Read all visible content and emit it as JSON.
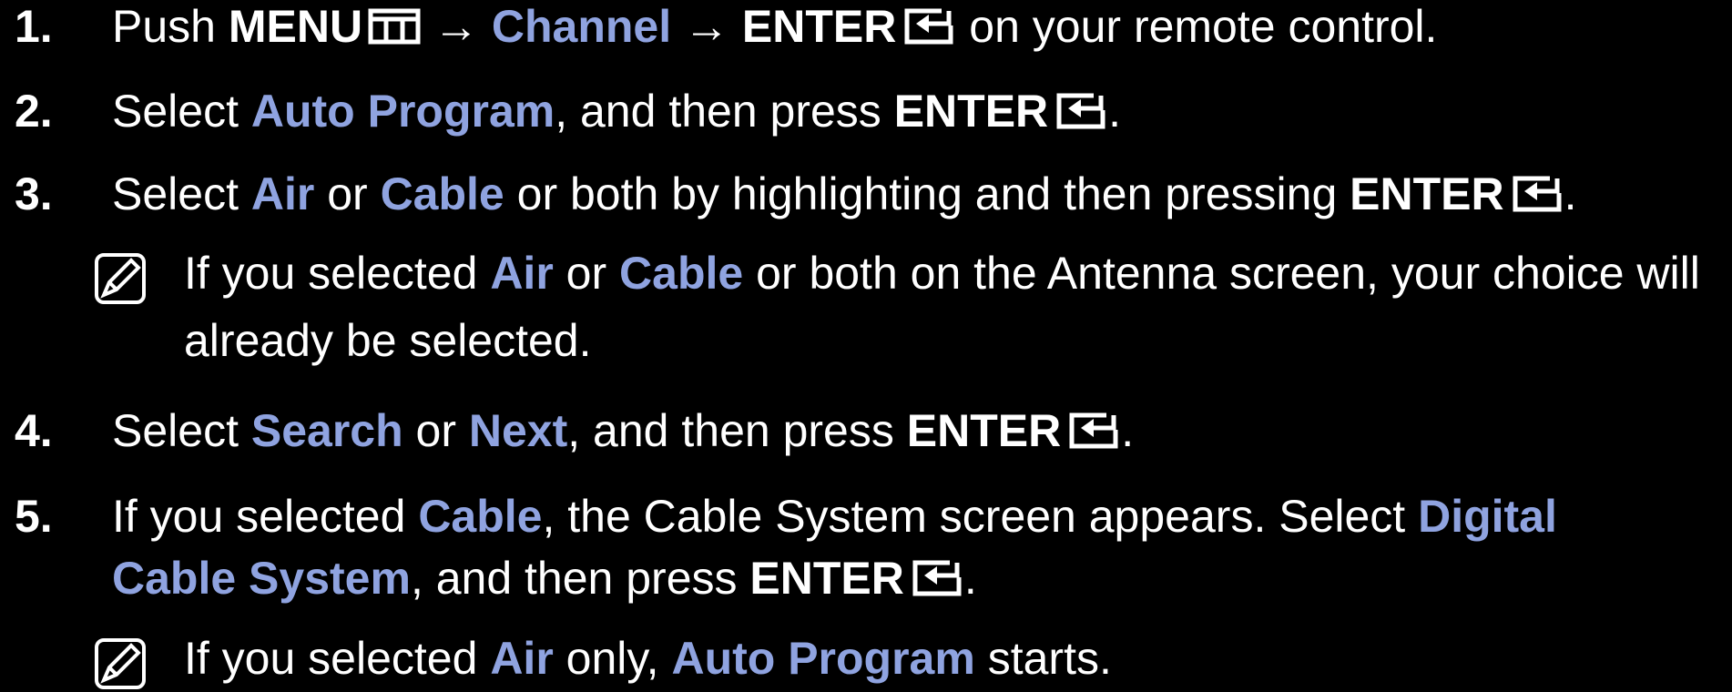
{
  "colors": {
    "background": "#000000",
    "text": "#ffffff",
    "highlight": "#8fa3e0"
  },
  "steps": [
    {
      "num": "1.",
      "parts": {
        "t1": "Push ",
        "b1": "MENU",
        "t2": " → ",
        "h1": "Channel",
        "t3": " → ",
        "b2": "ENTER",
        "t4": " on your remote control."
      }
    },
    {
      "num": "2.",
      "parts": {
        "t1": "Select ",
        "h1": "Auto Program",
        "t2": ", and then press ",
        "b1": "ENTER",
        "t3": "."
      }
    },
    {
      "num": "3.",
      "parts": {
        "t1": "Select ",
        "h1": "Air",
        "t2": " or ",
        "h2": "Cable",
        "t3": " or both by highlighting and then pressing ",
        "b1": "ENTER",
        "t4": "."
      }
    },
    {
      "num": "4.",
      "parts": {
        "t1": "Select ",
        "h1": "Search",
        "t2": " or ",
        "h2": "Next",
        "t3": ", and then press ",
        "b1": "ENTER",
        "t4": "."
      }
    },
    {
      "num": "5.",
      "parts": {
        "t1": "If you selected ",
        "h1": "Cable",
        "t2": ", the Cable System screen appears. Select ",
        "h2": "Digital",
        "h3": "Cable System",
        "t3": ", and then press ",
        "b1": "ENTER",
        "t4": "."
      }
    }
  ],
  "notes": [
    {
      "parts": {
        "t1": "If you selected ",
        "h1": "Air",
        "t2": " or ",
        "h2": "Cable",
        "t3": " or both on the Antenna screen, your choice will",
        "t4": "already be selected."
      }
    },
    {
      "parts": {
        "t1": "If you selected ",
        "h1": "Air",
        "t2": " only, ",
        "h2": "Auto Program",
        "t3": " starts."
      }
    }
  ],
  "icons": {
    "menu": "menu-icon",
    "enter": "enter-icon",
    "note": "note-icon"
  }
}
